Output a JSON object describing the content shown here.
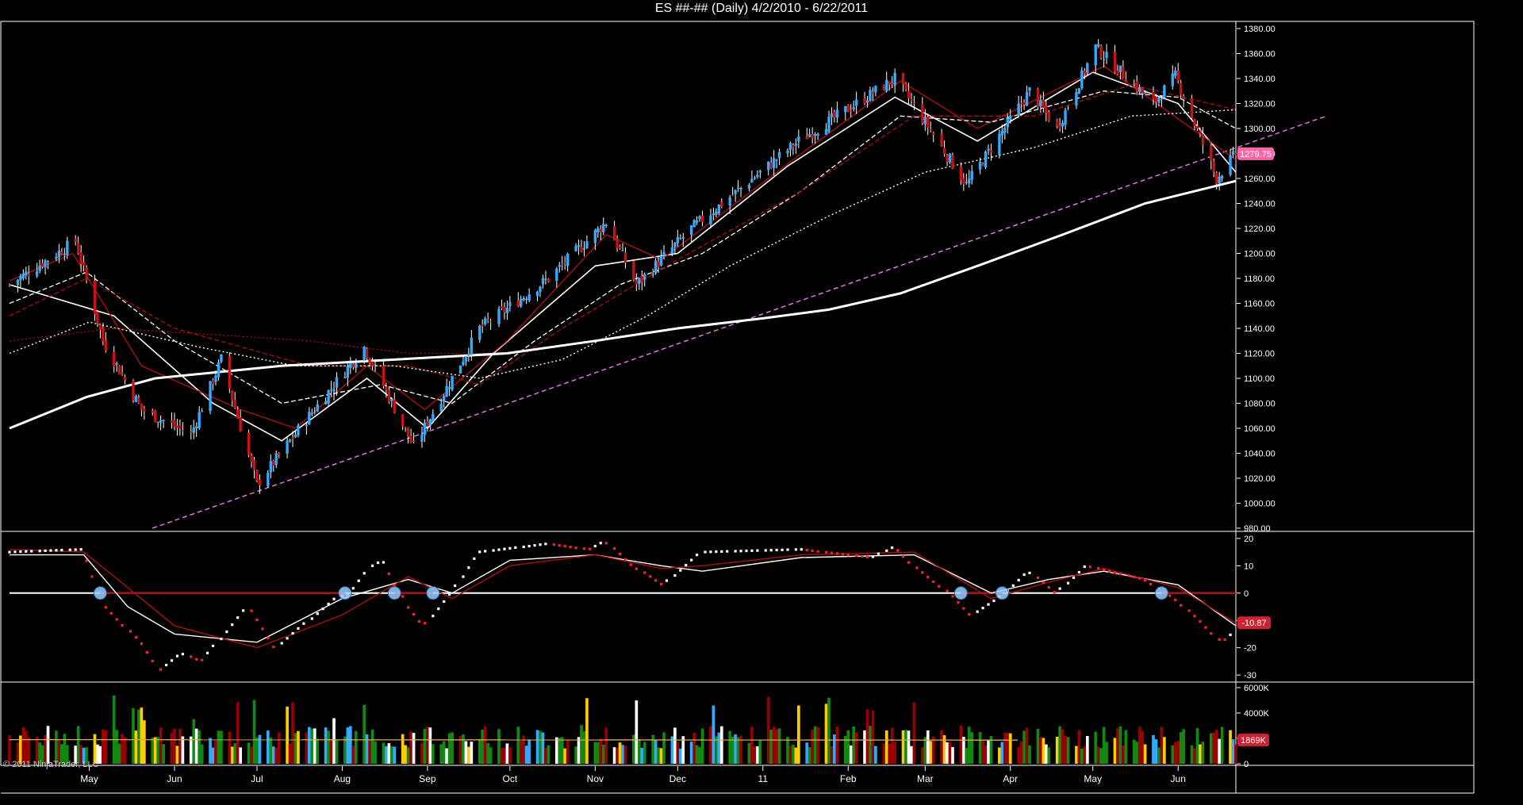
{
  "window": {
    "title": "ES ##-## (Daily)  4/2/2010 - 6/22/2011",
    "copyright": "© 2011 NinjaTrader, LLC"
  },
  "colors": {
    "background": "#000000",
    "frame": "#ffffff",
    "up_candle": "#33aaff",
    "down_candle": "#cc1111",
    "ma": "#ffffff",
    "ma_red": "#aa1111",
    "trendline": "#dd77dd",
    "last_price_badge": "#ff66aa",
    "osc_badge": "#cc2233",
    "vol_badge": "#cc2233",
    "vol_ma": "#ddaa55",
    "vol_green": "#118811",
    "vol_red": "#990000",
    "vol_white": "#ffffff",
    "vol_blue": "#33aaff",
    "vol_yellow": "#ffcc00",
    "osc_marker": "#99ccff"
  },
  "chart_data": [
    {
      "type": "candlestick",
      "panel": "price",
      "title": "ES ##-## (Daily)  4/2/2010 - 6/22/2011",
      "x_ticks": [
        "May",
        "Jun",
        "Jul",
        "Aug",
        "Sep",
        "Oct",
        "Nov",
        "Dec",
        "11",
        "Feb",
        "Mar",
        "Apr",
        "May",
        "Jun"
      ],
      "x_tick_dates": [
        "2010-05-01",
        "2010-06-01",
        "2010-07-01",
        "2010-08-01",
        "2010-09-01",
        "2010-10-01",
        "2010-11-01",
        "2010-12-01",
        "2011-01-01",
        "2011-02-01",
        "2011-03-01",
        "2011-04-01",
        "2011-05-01",
        "2011-06-01"
      ],
      "x_range": [
        "2010-04-02",
        "2011-06-22"
      ],
      "y_range": [
        980,
        1380
      ],
      "y_ticks": [
        980,
        1000,
        1020,
        1040,
        1060,
        1080,
        1100,
        1120,
        1140,
        1160,
        1180,
        1200,
        1220,
        1240,
        1260,
        1280,
        1300,
        1320,
        1340,
        1360,
        1380
      ],
      "y_tick_labels": [
        "980.00",
        "1000.00",
        "1020.00",
        "1040.00",
        "1060.00",
        "1080.00",
        "1100.00",
        "1120.00",
        "1140.00",
        "1160.00",
        "1180.00",
        "1200.00",
        "1220.00",
        "1240.00",
        "1260.00",
        "1280.00",
        "1300.00",
        "1320.00",
        "1340.00",
        "1360.00",
        "1380.00"
      ],
      "last_price": 1279.75,
      "last_price_label": "1279.75",
      "close_anchors": [
        [
          "2010-04-02",
          1175
        ],
        [
          "2010-04-26",
          1210
        ],
        [
          "2010-05-06",
          1130
        ],
        [
          "2010-05-20",
          1075
        ],
        [
          "2010-06-07",
          1055
        ],
        [
          "2010-06-18",
          1115
        ],
        [
          "2010-07-01",
          1015
        ],
        [
          "2010-07-20",
          1070
        ],
        [
          "2010-08-09",
          1125
        ],
        [
          "2010-08-27",
          1045
        ],
        [
          "2010-09-20",
          1140
        ],
        [
          "2010-10-15",
          1180
        ],
        [
          "2010-11-05",
          1225
        ],
        [
          "2010-11-16",
          1175
        ],
        [
          "2010-12-06",
          1220
        ],
        [
          "2011-01-14",
          1290
        ],
        [
          "2011-02-18",
          1340
        ],
        [
          "2011-03-01",
          1305
        ],
        [
          "2011-03-16",
          1255
        ],
        [
          "2011-04-08",
          1330
        ],
        [
          "2011-04-18",
          1300
        ],
        [
          "2011-05-02",
          1365
        ],
        [
          "2011-05-23",
          1320
        ],
        [
          "2011-05-31",
          1342
        ],
        [
          "2011-06-15",
          1260
        ],
        [
          "2011-06-22",
          1280
        ]
      ],
      "series": [
        {
          "name": "",
          "kind": "ma",
          "color": "#ffffff",
          "dash": "",
          "width": 1.6,
          "points": [
            [
              "2010-04-02",
              1175
            ],
            [
              "2010-05-10",
              1150
            ],
            [
              "2010-06-15",
              1080
            ],
            [
              "2010-07-10",
              1050
            ],
            [
              "2010-08-10",
              1100
            ],
            [
              "2010-09-01",
              1060
            ],
            [
              "2010-09-25",
              1120
            ],
            [
              "2010-11-01",
              1190
            ],
            [
              "2010-12-01",
              1200
            ],
            [
              "2011-01-10",
              1270
            ],
            [
              "2011-02-18",
              1325
            ],
            [
              "2011-03-20",
              1290
            ],
            [
              "2011-05-01",
              1345
            ],
            [
              "2011-06-01",
              1320
            ],
            [
              "2011-06-22",
              1265
            ]
          ]
        },
        {
          "name": "",
          "kind": "ma",
          "color": "#aa1111",
          "dash": "",
          "width": 1.4,
          "points": [
            [
              "2010-04-02",
              1178
            ],
            [
              "2010-04-25",
              1200
            ],
            [
              "2010-05-20",
              1110
            ],
            [
              "2010-06-25",
              1075
            ],
            [
              "2010-07-15",
              1060
            ],
            [
              "2010-08-10",
              1110
            ],
            [
              "2010-08-31",
              1075
            ],
            [
              "2010-09-30",
              1130
            ],
            [
              "2010-11-05",
              1215
            ],
            [
              "2010-11-25",
              1195
            ],
            [
              "2011-01-15",
              1280
            ],
            [
              "2011-02-20",
              1338
            ],
            [
              "2011-03-20",
              1300
            ],
            [
              "2011-05-05",
              1350
            ],
            [
              "2011-06-22",
              1275
            ]
          ]
        },
        {
          "name": "",
          "kind": "ma",
          "color": "#ffffff",
          "dash": "6,3",
          "width": 1.3,
          "points": [
            [
              "2010-04-02",
              1160
            ],
            [
              "2010-04-30",
              1185
            ],
            [
              "2010-06-01",
              1130
            ],
            [
              "2010-07-10",
              1080
            ],
            [
              "2010-08-15",
              1095
            ],
            [
              "2010-09-10",
              1080
            ],
            [
              "2010-10-10",
              1130
            ],
            [
              "2010-11-10",
              1175
            ],
            [
              "2010-12-10",
              1200
            ],
            [
              "2011-01-15",
              1250
            ],
            [
              "2011-02-20",
              1310
            ],
            [
              "2011-03-25",
              1305
            ],
            [
              "2011-05-05",
              1330
            ],
            [
              "2011-06-01",
              1325
            ],
            [
              "2011-06-22",
              1300
            ]
          ]
        },
        {
          "name": "",
          "kind": "ma",
          "color": "#aa1111",
          "dash": "6,3",
          "width": 1.3,
          "points": [
            [
              "2010-04-02",
              1150
            ],
            [
              "2010-04-30",
              1180
            ],
            [
              "2010-06-01",
              1140
            ],
            [
              "2010-07-20",
              1110
            ],
            [
              "2010-08-25",
              1110
            ],
            [
              "2010-09-20",
              1095
            ],
            [
              "2010-10-20",
              1140
            ],
            [
              "2010-12-01",
              1195
            ],
            [
              "2011-01-15",
              1250
            ],
            [
              "2011-02-25",
              1310
            ],
            [
              "2011-04-10",
              1310
            ],
            [
              "2011-05-15",
              1335
            ],
            [
              "2011-06-22",
              1315
            ]
          ]
        },
        {
          "name": "",
          "kind": "ma",
          "color": "#ffffff",
          "dash": "2,3",
          "width": 1.4,
          "points": [
            [
              "2010-04-02",
              1120
            ],
            [
              "2010-05-01",
              1145
            ],
            [
              "2010-06-10",
              1125
            ],
            [
              "2010-07-15",
              1110
            ],
            [
              "2010-08-20",
              1110
            ],
            [
              "2010-09-20",
              1100
            ],
            [
              "2010-10-20",
              1115
            ],
            [
              "2010-11-20",
              1150
            ],
            [
              "2010-12-20",
              1190
            ],
            [
              "2011-01-25",
              1230
            ],
            [
              "2011-03-01",
              1265
            ],
            [
              "2011-04-10",
              1285
            ],
            [
              "2011-05-15",
              1310
            ],
            [
              "2011-06-22",
              1315
            ]
          ]
        },
        {
          "name": "",
          "kind": "ma",
          "color": "#aa1111",
          "dash": "2,3",
          "width": 1.3,
          "points": [
            [
              "2010-04-02",
              1130
            ],
            [
              "2010-05-10",
              1140
            ],
            [
              "2010-06-15",
              1135
            ],
            [
              "2010-07-20",
              1130
            ],
            [
              "2010-08-25",
              1120
            ],
            [
              "2010-09-25",
              1120
            ]
          ]
        },
        {
          "name": "",
          "kind": "ma",
          "color": "#ffffff",
          "dash": "",
          "width": 3,
          "points": [
            [
              "2010-04-02",
              1060
            ],
            [
              "2010-04-30",
              1085
            ],
            [
              "2010-05-25",
              1100
            ],
            [
              "2010-07-10",
              1110
            ],
            [
              "2010-08-20",
              1115
            ],
            [
              "2010-09-30",
              1120
            ],
            [
              "2010-11-01",
              1130
            ],
            [
              "2010-12-01",
              1140
            ],
            [
              "2011-01-01",
              1148
            ],
            [
              "2011-01-25",
              1155
            ],
            [
              "2011-02-20",
              1168
            ],
            [
              "2011-03-20",
              1190
            ],
            [
              "2011-04-20",
              1215
            ],
            [
              "2011-05-20",
              1240
            ],
            [
              "2011-06-22",
              1258
            ]
          ]
        }
      ],
      "trendline": [
        [
          "2010-05-24",
          980
        ],
        [
          "2011-07-25",
          1310
        ]
      ],
      "last_price_line_from": "2011-06-22"
    },
    {
      "type": "line",
      "panel": "oscillator",
      "y_range": [
        -32,
        22
      ],
      "y_ticks": [
        -30,
        -20,
        -10,
        0,
        10,
        20
      ],
      "y_tick_labels": [
        "-30",
        "-20",
        "-10",
        "0",
        "10",
        "20"
      ],
      "last_value": -10.87,
      "last_value_label": "-10.87",
      "series": [
        {
          "name": "",
          "kind": "osc_fast",
          "points": [
            [
              "2010-04-02",
              15
            ],
            [
              "2010-04-29",
              16
            ],
            [
              "2010-05-07",
              -5
            ],
            [
              "2010-05-20",
              -18
            ],
            [
              "2010-05-27",
              -28
            ],
            [
              "2010-06-04",
              -22
            ],
            [
              "2010-06-11",
              -25
            ],
            [
              "2010-06-28",
              -5
            ],
            [
              "2010-07-08",
              -20
            ],
            [
              "2010-07-30",
              -2
            ],
            [
              "2010-08-04",
              0
            ],
            [
              "2010-08-12",
              10
            ],
            [
              "2010-08-16",
              12
            ],
            [
              "2010-08-25",
              -5
            ],
            [
              "2010-08-31",
              -12
            ],
            [
              "2010-09-10",
              0
            ],
            [
              "2010-09-20",
              15
            ],
            [
              "2010-10-15",
              18
            ],
            [
              "2010-10-30",
              16
            ],
            [
              "2010-11-05",
              19
            ],
            [
              "2010-11-15",
              10
            ],
            [
              "2010-11-26",
              3
            ],
            [
              "2010-12-10",
              15
            ],
            [
              "2011-01-15",
              16
            ],
            [
              "2011-02-10",
              13
            ],
            [
              "2011-02-18",
              17
            ],
            [
              "2011-02-25",
              10
            ],
            [
              "2011-03-10",
              0
            ],
            [
              "2011-03-18",
              -8
            ],
            [
              "2011-03-28",
              -2
            ],
            [
              "2011-04-08",
              8
            ],
            [
              "2011-04-18",
              0
            ],
            [
              "2011-04-29",
              10
            ],
            [
              "2011-05-20",
              5
            ],
            [
              "2011-05-31",
              -2
            ],
            [
              "2011-06-09",
              -10
            ],
            [
              "2011-06-17",
              -18
            ],
            [
              "2011-06-22",
              -14
            ]
          ]
        },
        {
          "name": "",
          "kind": "osc_signal",
          "color": "#ffffff",
          "points": [
            [
              "2010-04-02",
              14
            ],
            [
              "2010-04-29",
              14
            ],
            [
              "2010-05-15",
              -5
            ],
            [
              "2010-06-01",
              -15
            ],
            [
              "2010-07-01",
              -18
            ],
            [
              "2010-08-01",
              -2
            ],
            [
              "2010-08-25",
              5
            ],
            [
              "2010-09-10",
              0
            ],
            [
              "2010-10-01",
              12
            ],
            [
              "2010-11-01",
              14
            ],
            [
              "2010-11-25",
              10
            ],
            [
              "2010-12-10",
              8
            ],
            [
              "2011-01-15",
              13
            ],
            [
              "2011-02-25",
              14
            ],
            [
              "2011-03-25",
              0
            ],
            [
              "2011-04-15",
              5
            ],
            [
              "2011-05-05",
              8
            ],
            [
              "2011-06-01",
              3
            ],
            [
              "2011-06-22",
              -12
            ]
          ]
        },
        {
          "name": "",
          "kind": "osc_signal",
          "color": "#aa1111",
          "points": [
            [
              "2010-04-02",
              16
            ],
            [
              "2010-04-29",
              15
            ],
            [
              "2010-05-15",
              2
            ],
            [
              "2010-06-01",
              -12
            ],
            [
              "2010-07-01",
              -20
            ],
            [
              "2010-08-01",
              -8
            ],
            [
              "2010-08-25",
              6
            ],
            [
              "2010-09-10",
              -2
            ],
            [
              "2010-10-01",
              10
            ],
            [
              "2010-11-01",
              14
            ],
            [
              "2010-11-25",
              9
            ],
            [
              "2010-12-10",
              10
            ],
            [
              "2011-01-15",
              14
            ],
            [
              "2011-02-25",
              15
            ],
            [
              "2011-03-25",
              -2
            ],
            [
              "2011-04-15",
              4
            ],
            [
              "2011-05-05",
              9
            ],
            [
              "2011-06-01",
              2
            ],
            [
              "2011-06-22",
              -11
            ]
          ]
        }
      ],
      "zero_line_color": "#ffffff",
      "red_zero_segments": [
        [
          "2010-05-05",
          "2010-08-02"
        ],
        [
          "2010-08-20",
          "2010-09-03"
        ],
        [
          "2011-03-14",
          "2011-03-29"
        ],
        [
          "2011-05-26",
          "2011-06-22"
        ]
      ],
      "markers": [
        "2010-05-05",
        "2010-08-02",
        "2010-08-20",
        "2010-09-03",
        "2011-03-14",
        "2011-03-29",
        "2011-05-26"
      ]
    },
    {
      "type": "bar",
      "panel": "volume",
      "y_range": [
        0,
        6000
      ],
      "y_ticks": [
        0,
        2000,
        4000,
        6000
      ],
      "y_tick_labels": [
        "0",
        "",
        "4000K",
        "6000K"
      ],
      "last_value_label": "1869K",
      "volume_ma": 1900,
      "unit": "K"
    }
  ]
}
